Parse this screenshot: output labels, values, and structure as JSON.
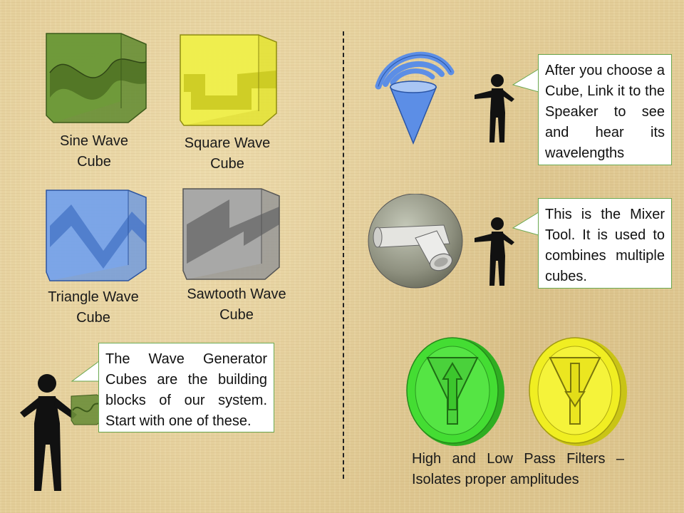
{
  "cubes": [
    {
      "label": "Sine Wave\nCube",
      "color": "#6b8e3a"
    },
    {
      "label": "Square Wave\nCube",
      "color": "#e8e83c"
    },
    {
      "label": "Triangle Wave\nCube",
      "color": "#6f9be0"
    },
    {
      "label": "Sawtooth Wave\nCube",
      "color": "#9a9a9a"
    }
  ],
  "bubbles": {
    "generator": "The Wave Generator Cubes are the building blocks of our system. Start with one of these.",
    "speaker": "After you choose a Cube, Link it to the Speaker to see and hear its wavelengths",
    "mixer": "This is the Mixer Tool. It is used to combines multiple cubes."
  },
  "filters_caption": "High and Low Pass Filters – Isolates proper amplitudes",
  "colors": {
    "high_pass": "#44dd33",
    "low_pass": "#f0ee22",
    "speaker": "#5c8ee6",
    "bubble_border": "#6aa84f"
  },
  "icons": [
    "speaker-icon",
    "mixer-icon",
    "high-pass-filter-icon",
    "low-pass-filter-icon",
    "person-icon"
  ]
}
